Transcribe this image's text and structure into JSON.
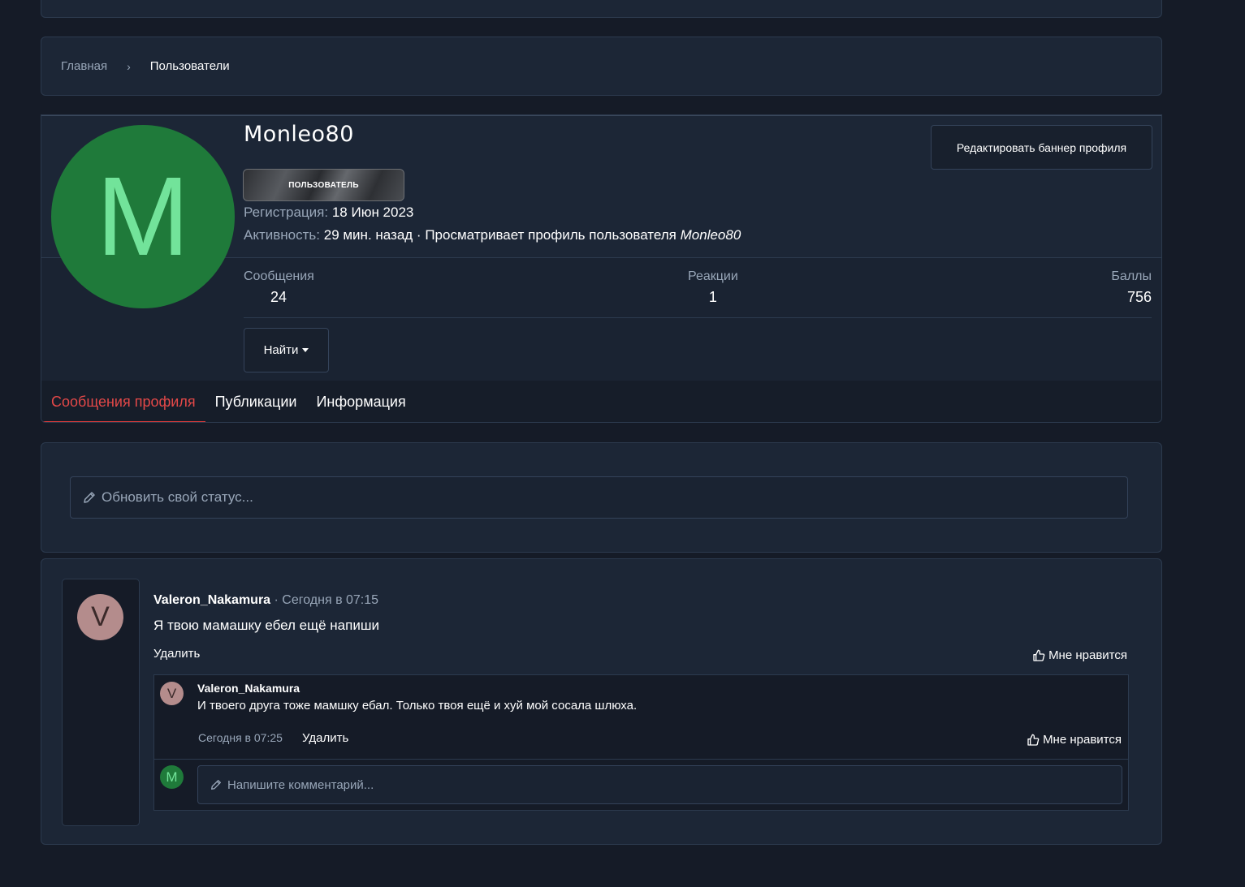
{
  "breadcrumb": {
    "home": "Главная",
    "separator": "›",
    "current": "Пользователи"
  },
  "profile": {
    "avatar_letter": "M",
    "username": "Monleo80",
    "banner_button": "Редактировать баннер профиля",
    "role_badge": "ПОЛЬЗОВАТЕЛЬ",
    "registration_label": "Регистрация:",
    "registration_value": "18 Июн 2023",
    "activity_label": "Активность:",
    "activity_value": "29 мин. назад · Просматривает профиль пользователя",
    "activity_target": "Monleo80",
    "colors": {
      "avatar_bg": "#1f7a3a",
      "avatar_letter": "#72e39a",
      "accent": "#e34848"
    }
  },
  "stats": {
    "messages_label": "Сообщения",
    "messages_value": "24",
    "reactions_label": "Реакции",
    "reactions_value": "1",
    "points_label": "Баллы",
    "points_value": "756"
  },
  "find_button": "Найти",
  "tabs": [
    {
      "label": "Сообщения профиля",
      "active": true
    },
    {
      "label": "Публикации",
      "active": false
    },
    {
      "label": "Информация",
      "active": false
    }
  ],
  "status_input": {
    "placeholder": "Обновить свой статус..."
  },
  "post": {
    "avatar_letter": "V",
    "author": "Valeron_Nakamura",
    "time": " · Сегодня в 07:15",
    "text": "Я твою мамашку ебел ещё напиши",
    "delete_label": "Удалить",
    "like_label": "Мне нравится"
  },
  "comment": {
    "avatar_letter": "V",
    "author": "Valeron_Nakamura",
    "text": "И твоего друга тоже мамшку ебал. Только твоя ещё и хуй мой сосала шлюха.",
    "time": "Сегодня в 07:25",
    "delete_label": "Удалить",
    "like_label": "Мне нравится"
  },
  "comment_input": {
    "avatar_letter": "M",
    "placeholder": "Напишите комментарий..."
  }
}
